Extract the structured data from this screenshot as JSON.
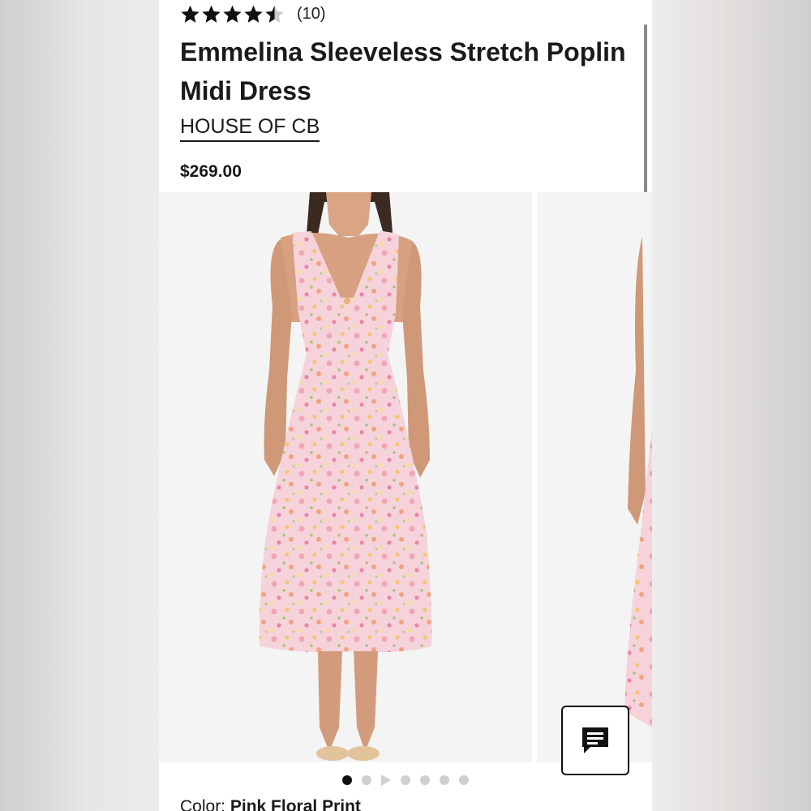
{
  "product": {
    "rating_value": 4.5,
    "rating_max": 5,
    "rating_count_label": "(10)",
    "title": "Emmelina Sleeveless Stretch Poplin Midi Dress",
    "brand": "HOUSE OF CB",
    "price": "$269.00",
    "color_label": "Color:",
    "color_value": "Pink Floral Print"
  },
  "gallery": {
    "slide_count": 7,
    "active_index": 0,
    "video_index": 2
  },
  "icons": {
    "star": "star-icon",
    "chat": "chat-icon",
    "play": "play-icon"
  },
  "colors": {
    "text": "#1a1a1a",
    "dress_base": "#f6d3da",
    "photo_bg": "#f4f4f4"
  }
}
